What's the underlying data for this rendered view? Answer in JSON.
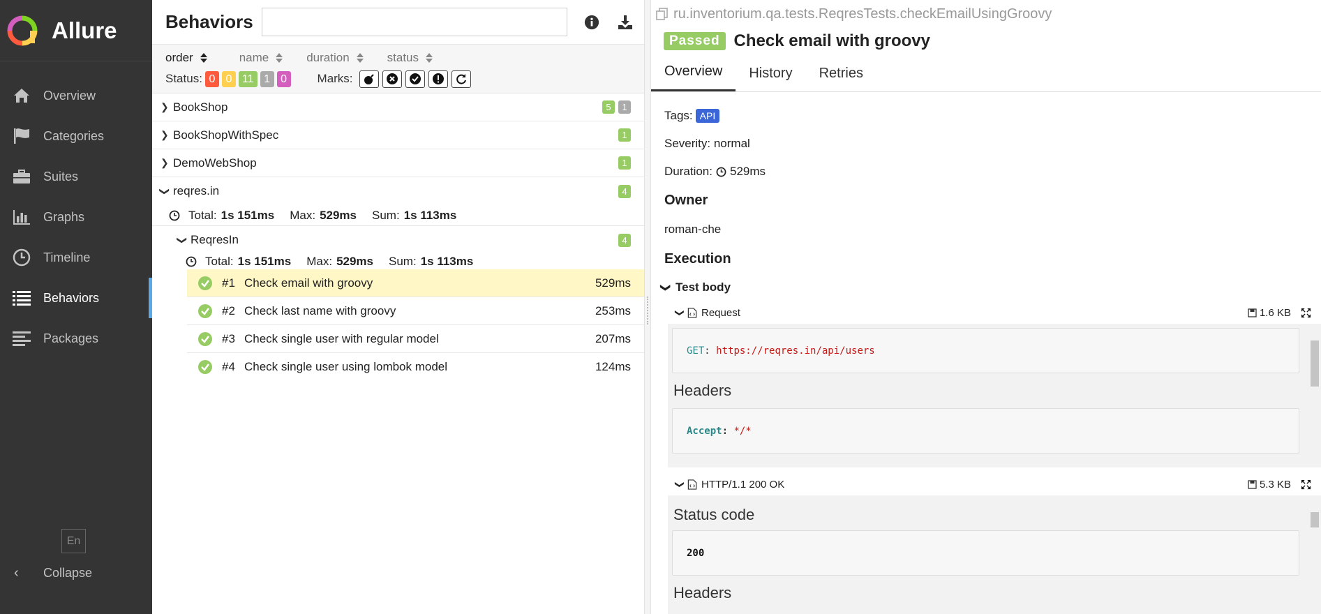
{
  "brand": {
    "name": "Allure"
  },
  "sidebar": {
    "items": [
      {
        "label": "Overview",
        "icon": "home-icon"
      },
      {
        "label": "Categories",
        "icon": "flag-icon"
      },
      {
        "label": "Suites",
        "icon": "briefcase-icon"
      },
      {
        "label": "Graphs",
        "icon": "bar-chart-icon"
      },
      {
        "label": "Timeline",
        "icon": "clock-icon"
      },
      {
        "label": "Behaviors",
        "icon": "list-icon"
      },
      {
        "label": "Packages",
        "icon": "align-left-icon"
      }
    ],
    "active": "Behaviors",
    "lang": "En",
    "collapse": "Collapse"
  },
  "behaviors": {
    "title": "Behaviors",
    "search_value": "",
    "sort": [
      "order",
      "name",
      "duration",
      "status"
    ],
    "status_label": "Status:",
    "status_counts": {
      "failed": "0",
      "broken": "0",
      "passed": "11",
      "skipped": "1",
      "unknown": "0"
    },
    "marks_label": "Marks:",
    "groups": [
      {
        "name": "BookShop",
        "passed": "5",
        "skipped": "1"
      },
      {
        "name": "BookShopWithSpec",
        "passed": "1"
      },
      {
        "name": "DemoWebShop",
        "passed": "1"
      },
      {
        "name": "reqres.in",
        "passed": "4"
      }
    ],
    "reqres_stats": {
      "total_label": "Total:",
      "total": "1s 151ms",
      "max_label": "Max:",
      "max": "529ms",
      "sum_label": "Sum:",
      "sum": "1s 113ms"
    },
    "subgroup": {
      "name": "ReqresIn",
      "passed": "4"
    },
    "sub_stats": {
      "total_label": "Total:",
      "total": "1s 151ms",
      "max_label": "Max:",
      "max": "529ms",
      "sum_label": "Sum:",
      "sum": "1s 113ms"
    },
    "tests": [
      {
        "num": "#1",
        "name": "Check email with groovy",
        "duration": "529ms"
      },
      {
        "num": "#2",
        "name": "Check last name with groovy",
        "duration": "253ms"
      },
      {
        "num": "#3",
        "name": "Check single user with regular model",
        "duration": "207ms"
      },
      {
        "num": "#4",
        "name": "Check single user using lombok model",
        "duration": "124ms"
      }
    ]
  },
  "detail": {
    "fullname": "ru.inventorium.qa.tests.ReqresTests.checkEmailUsingGroovy",
    "status": "Passed",
    "title": "Check email with groovy",
    "tabs": [
      "Overview",
      "History",
      "Retries"
    ],
    "tags_label": "Tags:",
    "tag": "API",
    "severity": "Severity: normal",
    "duration_label": "Duration:",
    "duration": "529ms",
    "owner_heading": "Owner",
    "owner": "roman-che",
    "execution_heading": "Execution",
    "step": "Test body",
    "request": {
      "name": "Request",
      "size": "1.6 KB",
      "method": "GET",
      "url": "https://reqres.in/api/users",
      "headers_heading": "Headers",
      "header_key": "Accept",
      "header_value": "*/*"
    },
    "response": {
      "name": "HTTP/1.1 200 OK",
      "size": "5.3 KB",
      "status_heading": "Status code",
      "status_code": "200",
      "headers_heading": "Headers"
    }
  },
  "colors": {
    "sidebar_bg": "#343434",
    "active_accent": "#5aa9e6",
    "passed": "#97cc64",
    "failed": "#fd5a3e",
    "broken": "#ffd050",
    "skipped": "#aaaaaa",
    "unknown": "#d35ebe",
    "selected_row": "#fff7c6",
    "tag": "#3a66d8"
  }
}
